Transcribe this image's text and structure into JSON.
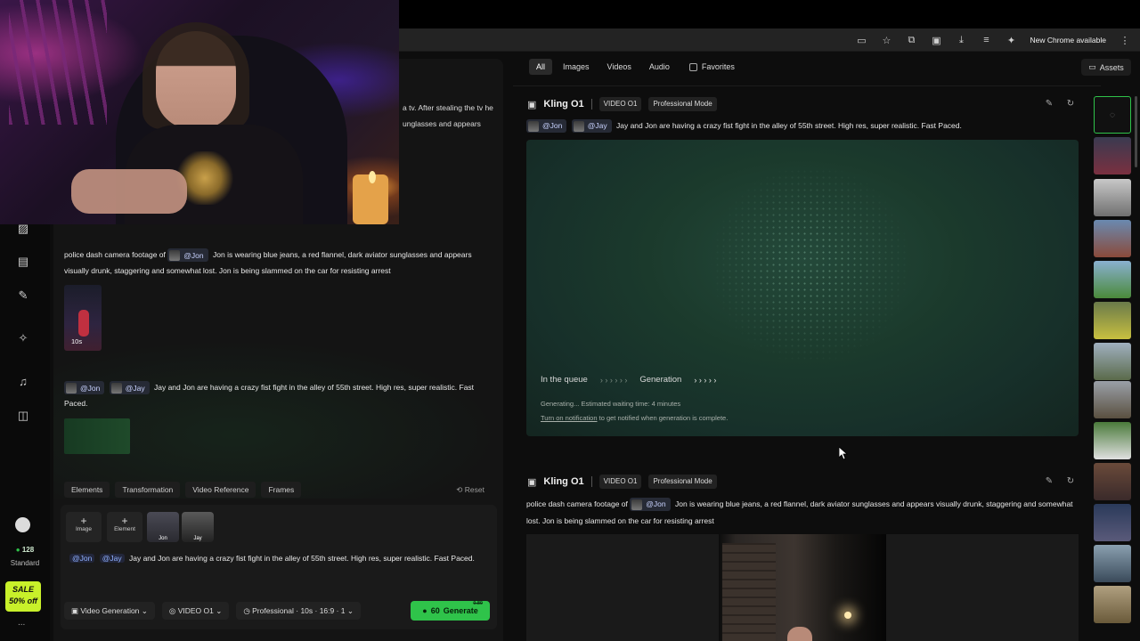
{
  "browser": {
    "new_chrome": "New Chrome available",
    "menu_icon": "kebab-icon"
  },
  "left": {
    "partial_line_1": "a tv. After stealing the tv he",
    "partial_line_2": "unglasses and appears",
    "msg1": {
      "prefix": "police dash camera footage of",
      "chip": "Jon",
      "text": "Jon is wearing blue jeans, a red flannel, dark aviator sunglasses and appears visually drunk, staggering and somewhat lost. Jon is being slammed on the car for resisting arrest",
      "duration": "10s"
    },
    "msg2": {
      "chip1": "Jon",
      "chip2": "Jay",
      "text": "Jay and Jon are having a crazy fist fight in the alley of 55th street. High res, super realistic. Fast Paced."
    },
    "tabs": [
      "Elements",
      "Transformation",
      "Video Reference",
      "Frames"
    ],
    "reset": "Reset",
    "composer": {
      "add_image": "Image",
      "add_element": "Element",
      "ref1": "Jon",
      "ref2": "Jay",
      "chip1": "Jon",
      "chip2": "Jay",
      "text": "Jay and Jon are having a crazy fist fight in the alley of 55th street. High res, super realistic. Fast Paced."
    },
    "bottom": {
      "mode": "Video Generation",
      "model": "VIDEO O1",
      "settings": "Professional · 10s · 16:9 · 1",
      "generate_cost": "60",
      "generate_label": "Generate",
      "old_cost": "0.80"
    }
  },
  "sidebar": {
    "credits": "128",
    "tier": "Standard",
    "sale_line1": "SALE",
    "sale_line2": "50% off",
    "more": "..."
  },
  "filters": {
    "items": [
      "All",
      "Images",
      "Videos",
      "Audio"
    ],
    "active": "All",
    "favorites": "Favorites",
    "assets": "Assets"
  },
  "gen1": {
    "title": "Kling O1",
    "tag1": "VIDEO O1",
    "tag2": "Professional Mode",
    "chip1": "Jon",
    "chip2": "Jay",
    "prompt": "Jay and Jon are having a crazy fist fight in the alley of 55th street. High res, super realistic. Fast Paced.",
    "step1": "In the queue",
    "step2": "Generation",
    "arrows": "› › › › › ›",
    "arrows2": "› › › › ›",
    "status": "Generating... Estimated waiting time: 4 minutes",
    "notify_link": "Turn on notification",
    "notify_rest": "to get notified when generation is complete."
  },
  "gen2": {
    "title": "Kling O1",
    "tag1": "VIDEO O1",
    "tag2": "Professional Mode",
    "prefix": "police dash camera footage of",
    "chip": "Jon",
    "line1": "Jon is wearing blue jeans, a red flannel, dark aviator sunglasses and appears visually drunk, staggering and",
    "line2": "somewhat lost. Jon is being slammed on the car for resisting arrest"
  },
  "colors": {
    "accent_green": "#2fc34a",
    "sale_yellow": "#c8f02a",
    "chip_blue": "#c9d3ff"
  }
}
